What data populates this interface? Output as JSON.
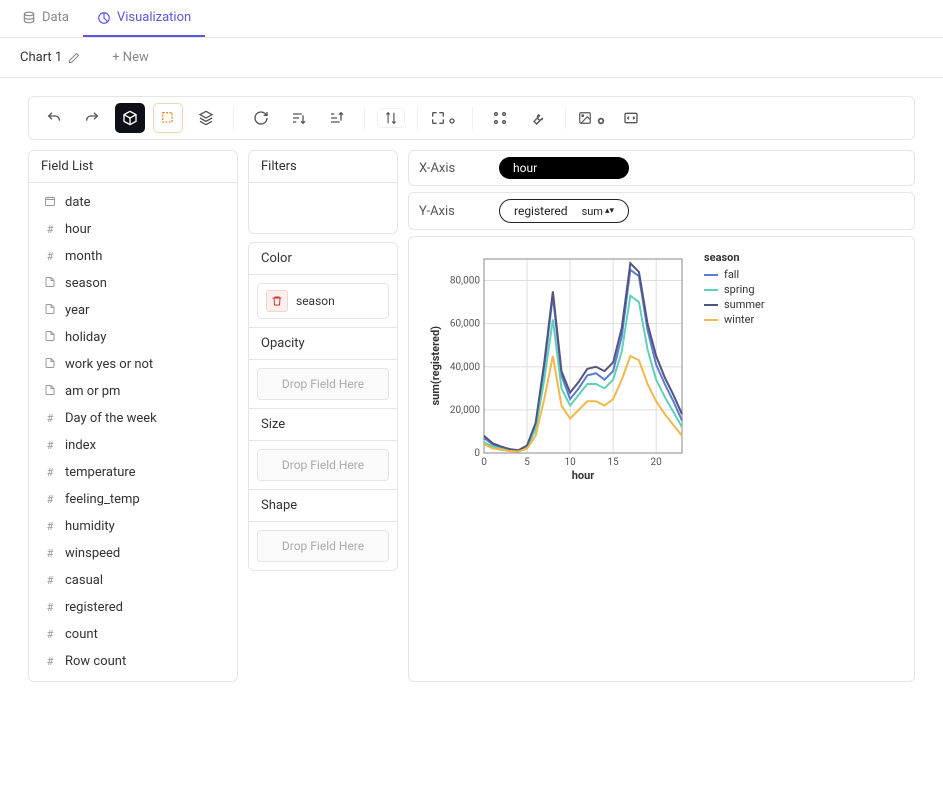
{
  "top_tabs": {
    "data": "Data",
    "viz": "Visualization"
  },
  "chart_tabs": {
    "chart1": "Chart 1",
    "new": "+ New"
  },
  "field_list": {
    "header": "Field List",
    "items": [
      {
        "type": "date",
        "label": "date"
      },
      {
        "type": "num",
        "label": "hour"
      },
      {
        "type": "num",
        "label": "month"
      },
      {
        "type": "cat",
        "label": "season"
      },
      {
        "type": "cat",
        "label": "year"
      },
      {
        "type": "cat",
        "label": "holiday"
      },
      {
        "type": "cat",
        "label": "work yes or not"
      },
      {
        "type": "cat",
        "label": "am or pm"
      },
      {
        "type": "num",
        "label": "Day of the week"
      },
      {
        "type": "num",
        "label": "index"
      },
      {
        "type": "num",
        "label": "temperature"
      },
      {
        "type": "num",
        "label": "feeling_temp"
      },
      {
        "type": "num",
        "label": "humidity"
      },
      {
        "type": "num",
        "label": "winspeed"
      },
      {
        "type": "num",
        "label": "casual"
      },
      {
        "type": "num",
        "label": "registered"
      },
      {
        "type": "num",
        "label": "count"
      },
      {
        "type": "num",
        "label": "Row count"
      }
    ]
  },
  "encodings": {
    "filters": "Filters",
    "color": "Color",
    "color_field": "season",
    "opacity": "Opacity",
    "size": "Size",
    "shape": "Shape",
    "drop_hint": "Drop Field Here"
  },
  "axes": {
    "x_label": "X-Axis",
    "y_label": "Y-Axis",
    "x_field": "hour",
    "y_field": "registered",
    "y_agg": "sum"
  },
  "chart_data": {
    "type": "line",
    "title": "",
    "xlabel": "hour",
    "ylabel": "sum(registered)",
    "xlim": [
      0,
      23
    ],
    "ylim": [
      0,
      90000
    ],
    "x": [
      0,
      1,
      2,
      3,
      4,
      5,
      6,
      7,
      8,
      9,
      10,
      11,
      12,
      13,
      14,
      15,
      16,
      17,
      18,
      19,
      20,
      21,
      22,
      23
    ],
    "series": [
      {
        "name": "fall",
        "color": "#5b7bd5",
        "values": [
          7000,
          4000,
          2500,
          1500,
          1000,
          3000,
          13000,
          40000,
          73000,
          36000,
          25000,
          30000,
          36000,
          37000,
          34000,
          38000,
          54000,
          85000,
          82000,
          57000,
          41000,
          32000,
          24000,
          15000
        ]
      },
      {
        "name": "spring",
        "color": "#5fd0b8",
        "values": [
          5000,
          3000,
          2000,
          1200,
          900,
          2500,
          11000,
          34000,
          62000,
          30000,
          22000,
          27000,
          32000,
          32000,
          30000,
          34000,
          47000,
          73000,
          70000,
          48000,
          34000,
          26000,
          19000,
          12000
        ]
      },
      {
        "name": "summer",
        "color": "#52557d",
        "values": [
          8000,
          4500,
          3000,
          1800,
          1300,
          3500,
          14000,
          42000,
          75000,
          38000,
          28000,
          33000,
          39000,
          40000,
          38000,
          42000,
          58000,
          88000,
          84000,
          60000,
          45000,
          35000,
          27000,
          18000
        ]
      },
      {
        "name": "winter",
        "color": "#f2b84b",
        "values": [
          4000,
          2200,
          1500,
          900,
          700,
          2000,
          8000,
          25000,
          45000,
          22000,
          16000,
          20000,
          24000,
          24000,
          22000,
          25000,
          34000,
          45000,
          43000,
          32000,
          24000,
          18000,
          13000,
          8000
        ]
      }
    ],
    "legend_title": "season"
  }
}
